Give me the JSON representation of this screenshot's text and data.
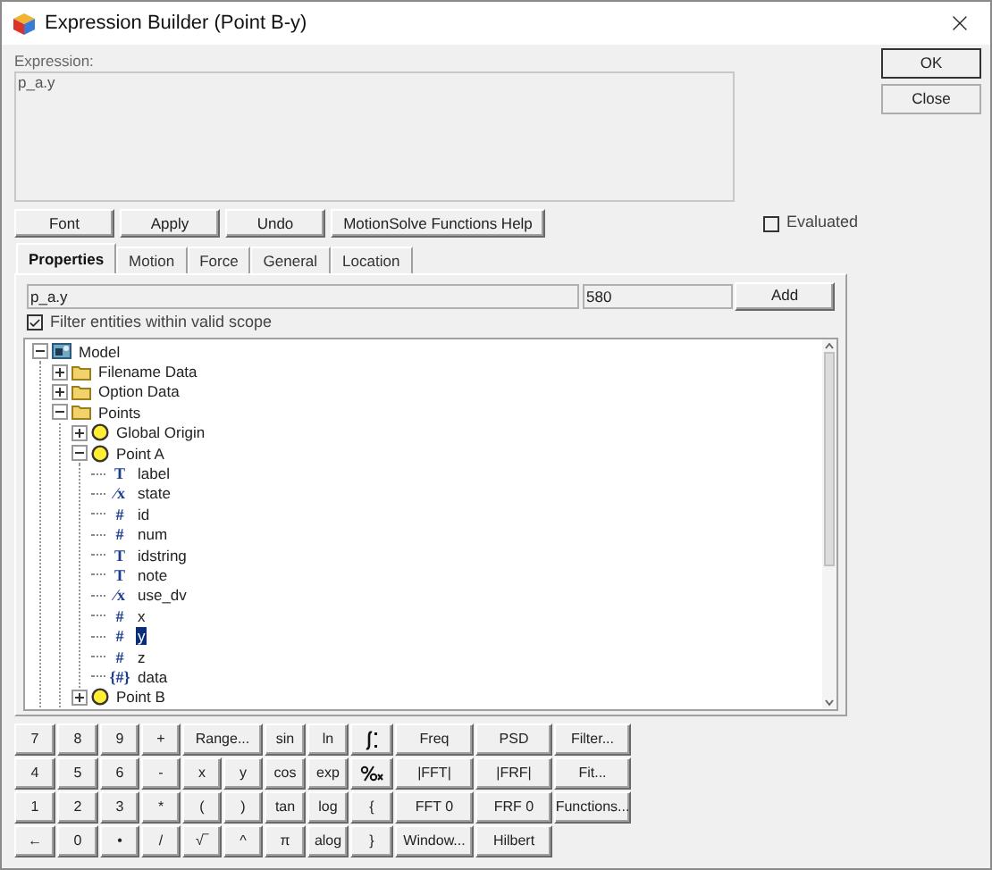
{
  "window": {
    "title": "Expression Builder (Point B-y)"
  },
  "expression": {
    "label": "Expression:",
    "value": "p_a.y"
  },
  "toolbar_buttons": [
    "Font",
    "Apply",
    "Undo",
    "MotionSolve Functions Help"
  ],
  "evaluated": {
    "label": "Evaluated",
    "checked": false
  },
  "tabs": [
    {
      "label": "Properties",
      "selected": true
    },
    {
      "label": "Motion",
      "selected": false
    },
    {
      "label": "Force",
      "selected": false
    },
    {
      "label": "General",
      "selected": false
    },
    {
      "label": "Location",
      "selected": false
    }
  ],
  "entity_field": {
    "value": "p_a.y"
  },
  "id_field": {
    "value": "580"
  },
  "add_button": "Add",
  "filter": {
    "label": "Filter entities within valid scope",
    "checked": true
  },
  "tree": [
    {
      "label": "Model",
      "kind": "model",
      "expanded": true,
      "selected": false,
      "children": [
        {
          "label": "Filename Data",
          "kind": "folder",
          "expanded": false,
          "selected": false
        },
        {
          "label": "Option Data",
          "kind": "folder",
          "expanded": false,
          "selected": false
        },
        {
          "label": "Points",
          "kind": "folder",
          "expanded": true,
          "selected": false,
          "children": [
            {
              "label": "Global Origin",
              "kind": "point",
              "expanded": false,
              "selected": false
            },
            {
              "label": "Point A",
              "kind": "point",
              "expanded": true,
              "selected": false,
              "children": [
                {
                  "label": "label",
                  "kind": "property",
                  "glyph": "T",
                  "selected": false
                },
                {
                  "label": "state",
                  "kind": "property",
                  "glyph": "⁄x",
                  "selected": false
                },
                {
                  "label": "id",
                  "kind": "property",
                  "glyph": "#",
                  "selected": false
                },
                {
                  "label": "num",
                  "kind": "property",
                  "glyph": "#",
                  "selected": false
                },
                {
                  "label": "idstring",
                  "kind": "property",
                  "glyph": "T",
                  "selected": false
                },
                {
                  "label": "note",
                  "kind": "property",
                  "glyph": "T",
                  "selected": false
                },
                {
                  "label": "use_dv",
                  "kind": "property",
                  "glyph": "⁄x",
                  "selected": false
                },
                {
                  "label": "x",
                  "kind": "property",
                  "glyph": "#",
                  "selected": false
                },
                {
                  "label": "y",
                  "kind": "property",
                  "glyph": "#",
                  "selected": true
                },
                {
                  "label": "z",
                  "kind": "property",
                  "glyph": "#",
                  "selected": false
                },
                {
                  "label": "data",
                  "kind": "property",
                  "glyph": "{#}",
                  "selected": false
                }
              ]
            },
            {
              "label": "Point B",
              "kind": "point",
              "expanded": false,
              "selected": false
            }
          ]
        }
      ]
    }
  ],
  "keypad": [
    {
      "kind": "key",
      "label": "7"
    },
    {
      "kind": "key",
      "label": "8"
    },
    {
      "kind": "key",
      "label": "9"
    },
    {
      "kind": "key",
      "label": "+"
    },
    {
      "kind": "wide",
      "label": "Range..."
    },
    {
      "kind": "key",
      "label": "sin"
    },
    {
      "kind": "key",
      "label": "ln"
    },
    {
      "kind": "integral"
    },
    {
      "kind": "key",
      "label": "Freq"
    },
    {
      "kind": "key",
      "label": "PSD"
    },
    {
      "kind": "key",
      "label": "Filter..."
    },
    {
      "kind": "key",
      "label": "4"
    },
    {
      "kind": "key",
      "label": "5"
    },
    {
      "kind": "key",
      "label": "6"
    },
    {
      "kind": "key",
      "label": "-"
    },
    {
      "kind": "key",
      "label": "x"
    },
    {
      "kind": "key",
      "label": "y"
    },
    {
      "kind": "key",
      "label": "cos"
    },
    {
      "kind": "key",
      "label": "exp"
    },
    {
      "kind": "derivative"
    },
    {
      "kind": "key",
      "label": "|FFT|"
    },
    {
      "kind": "key",
      "label": "|FRF|"
    },
    {
      "kind": "key",
      "label": "Fit..."
    },
    {
      "kind": "key",
      "label": "1"
    },
    {
      "kind": "key",
      "label": "2"
    },
    {
      "kind": "key",
      "label": "3"
    },
    {
      "kind": "key",
      "label": "*"
    },
    {
      "kind": "key",
      "label": "("
    },
    {
      "kind": "key",
      "label": ")"
    },
    {
      "kind": "key",
      "label": "tan"
    },
    {
      "kind": "key",
      "label": "log"
    },
    {
      "kind": "key",
      "label": "{"
    },
    {
      "kind": "key",
      "label": "FFT 0"
    },
    {
      "kind": "key",
      "label": "FRF 0"
    },
    {
      "kind": "key",
      "label": "Functions..."
    },
    {
      "kind": "key",
      "label": "←"
    },
    {
      "kind": "key",
      "label": "0"
    },
    {
      "kind": "key",
      "label": "•"
    },
    {
      "kind": "key",
      "label": "/"
    },
    {
      "kind": "key",
      "label": "√‾"
    },
    {
      "kind": "key",
      "label": "^"
    },
    {
      "kind": "key",
      "label": "π"
    },
    {
      "kind": "key",
      "label": "alog"
    },
    {
      "kind": "key",
      "label": "}"
    },
    {
      "kind": "key",
      "label": "Window..."
    },
    {
      "kind": "key",
      "label": "Hilbert"
    }
  ],
  "dialog_buttons": [
    "OK",
    "Close"
  ]
}
